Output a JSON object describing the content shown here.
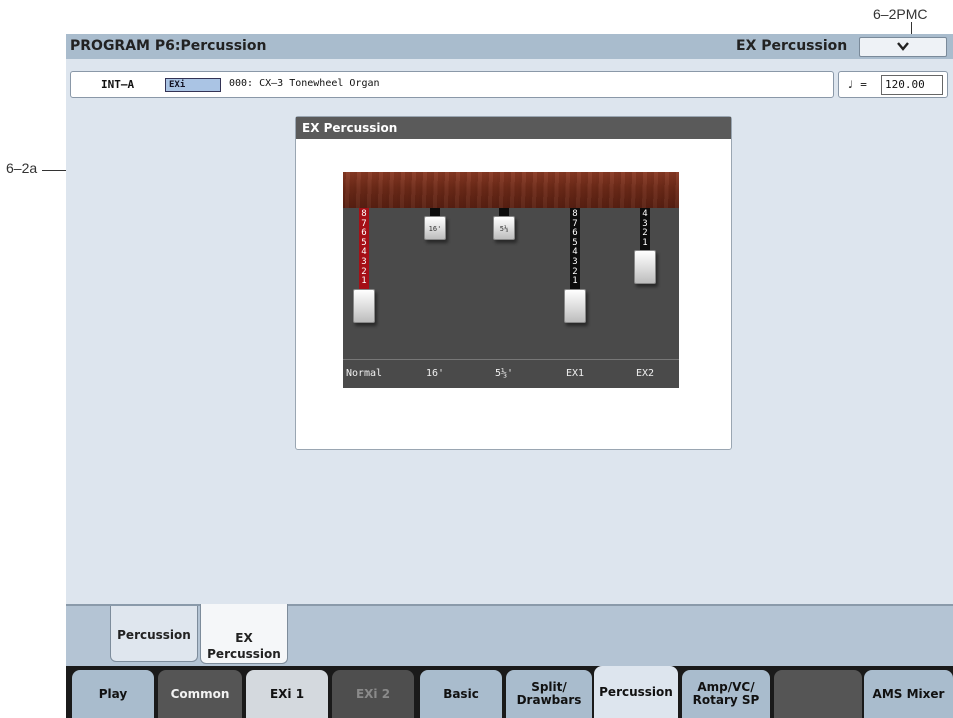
{
  "callouts": {
    "top_right": "6–2PMC",
    "left": "6–2a"
  },
  "header": {
    "title": "PROGRAM P6:Percussion",
    "page_name": "EX Percussion",
    "menu_icon": "chevron-down-icon"
  },
  "program": {
    "bank": "INT–A",
    "type": "EXi",
    "name": "000: CX–3 Tonewheel Organ"
  },
  "tempo": {
    "symbol": "♩ =",
    "value": "120.00"
  },
  "panel": {
    "title": "EX Percussion",
    "drawbars": [
      {
        "label": "Normal",
        "style": "red",
        "numbers": [
          "8",
          "7",
          "6",
          "5",
          "4",
          "3",
          "2",
          "1"
        ],
        "position": 0,
        "knob_label": ""
      },
      {
        "label": "16'",
        "style": "black",
        "numbers": [],
        "position": 8,
        "knob_label": "16'"
      },
      {
        "label": "5⅓'",
        "style": "black",
        "numbers": [],
        "position": 8,
        "knob_label": "5⅓"
      },
      {
        "label": "EX1",
        "style": "black",
        "numbers": [
          "8",
          "7",
          "6",
          "5",
          "4",
          "3",
          "2",
          "1"
        ],
        "position": 0,
        "knob_label": ""
      },
      {
        "label": "EX2",
        "style": "black",
        "numbers": [
          "4",
          "3",
          "2",
          "1"
        ],
        "position": 4,
        "knob_label": ""
      }
    ]
  },
  "subtabs": [
    {
      "label": "Percussion",
      "active": false
    },
    {
      "label": "EX\nPercussion",
      "active": true
    }
  ],
  "modetabs": [
    {
      "label": "Play",
      "style": "blue"
    },
    {
      "label": "Common",
      "style": "dark"
    },
    {
      "label": "EXi 1",
      "style": "grey"
    },
    {
      "label": "EXi 2",
      "style": "dis"
    },
    {
      "label": "Basic",
      "style": "blue"
    },
    {
      "label": "Split/\nDrawbars",
      "style": "blue"
    },
    {
      "label": "Percussion",
      "style": "active"
    },
    {
      "label": "Amp/VC/\nRotary SP",
      "style": "blue"
    },
    {
      "label": "",
      "style": "dark"
    },
    {
      "label": "AMS Mixer",
      "style": "blue"
    }
  ],
  "colors": {
    "title_bar": "#a9bccd",
    "screen_bg": "#dde5ee",
    "drawbar_red": "#a50f16",
    "wood": "#6e2a18"
  }
}
